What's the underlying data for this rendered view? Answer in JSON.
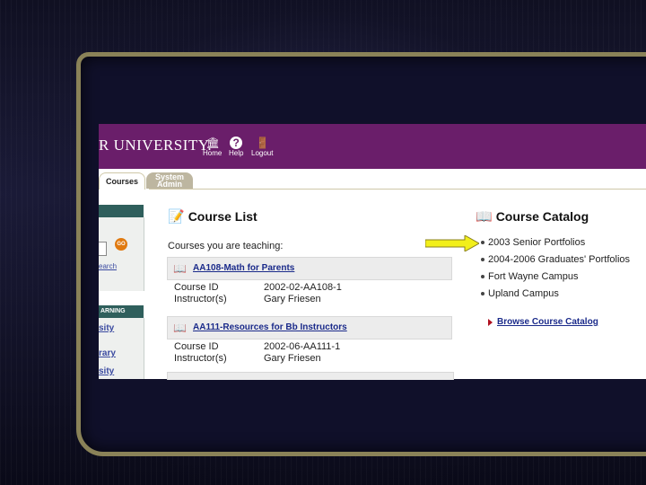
{
  "header": {
    "brand": "R UNIVERSITY.",
    "nav": [
      {
        "label": "Home",
        "icon": "home-icon"
      },
      {
        "label": "Help",
        "icon": "help-icon"
      },
      {
        "label": "Logout",
        "icon": "logout-icon"
      }
    ],
    "banner_color": "#6a1e6a"
  },
  "tabs": [
    {
      "label": "Courses",
      "active": true
    },
    {
      "label": "System Admin",
      "line1": "System",
      "line2": "Admin",
      "active": false
    }
  ],
  "left_sidebar": {
    "search_go": "GO",
    "search_link": "earch",
    "section_header": "ARNING",
    "links": [
      "sity",
      "rary",
      "sity"
    ]
  },
  "course_list": {
    "title": "Course List",
    "subtitle": "Courses you are teaching:",
    "courses": [
      {
        "name": "AA108-Math for Parents",
        "id_label": "Course ID",
        "id_value": "2002-02-AA108-1",
        "instructor_label": "Instructor(s)",
        "instructor_value": "Gary Friesen"
      },
      {
        "name": "AA111-Resources for Bb Instructors",
        "id_label": "Course ID",
        "id_value": "2002-06-AA111-1",
        "instructor_label": "Instructor(s)",
        "instructor_value": "Gary Friesen"
      }
    ]
  },
  "course_catalog": {
    "title": "Course Catalog",
    "items": [
      "2003 Senior Portfolios",
      "2004-2006 Graduates' Portfolios",
      "Fort Wayne Campus",
      "Upland Campus"
    ],
    "browse_label": "Browse Course Catalog"
  },
  "colors": {
    "accent": "#6a1e6a",
    "sidebar_header": "#2f5f5c",
    "link": "#1a2a8a",
    "pointer_arrow": "#f2ef1a"
  }
}
